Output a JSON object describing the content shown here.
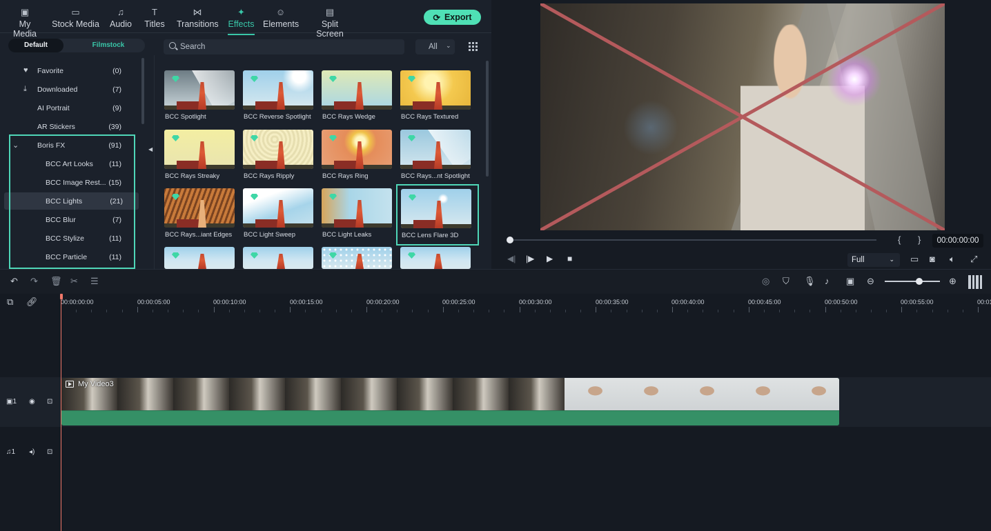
{
  "nav": {
    "tabs": [
      {
        "label": "My Media",
        "icon": "image-icon"
      },
      {
        "label": "Stock Media",
        "icon": "folder-icon"
      },
      {
        "label": "Audio",
        "icon": "music-icon"
      },
      {
        "label": "Titles",
        "icon": "text-t-icon"
      },
      {
        "label": "Transitions",
        "icon": "bowtie-icon"
      },
      {
        "label": "Effects",
        "icon": "sparkle-icon"
      },
      {
        "label": "Elements",
        "icon": "smiley-icon"
      },
      {
        "label": "Split Screen",
        "icon": "split-screen-icon"
      }
    ],
    "active": "Effects",
    "export_label": "Export"
  },
  "library": {
    "segment": [
      "Default",
      "Filmstock"
    ],
    "categories": [
      {
        "label": "Favorite",
        "count": "(0)",
        "icon": "heart-icon"
      },
      {
        "label": "Downloaded",
        "count": "(7)",
        "icon": "download-icon"
      },
      {
        "label": "AI Portrait",
        "count": "(9)"
      },
      {
        "label": "AR Stickers",
        "count": "(39)"
      },
      {
        "label": "Boris FX",
        "count": "(91)",
        "icon": "chevron-down-icon"
      },
      {
        "label": "BCC Art Looks",
        "count": "(11)"
      },
      {
        "label": "BCC Image Rest...",
        "count": "(15)"
      },
      {
        "label": "BCC Lights",
        "count": "(21)"
      },
      {
        "label": "BCC Blur",
        "count": "(7)"
      },
      {
        "label": "BCC Stylize",
        "count": "(11)"
      },
      {
        "label": "BCC Particle",
        "count": "(11)"
      }
    ],
    "selected": "BCC Lights"
  },
  "effects": {
    "search_placeholder": "Search",
    "filter_value": "All",
    "items": [
      "BCC Spotlight",
      "BCC Reverse Spotlight",
      "BCC Rays Wedge",
      "BCC Rays Textured",
      "BCC Rays Streaky",
      "BCC Rays Ripply",
      "BCC Rays Ring",
      "BCC Rays...nt Spotlight",
      "BCC Rays...iant Edges",
      "BCC Light Sweep",
      "BCC Light Leaks",
      "BCC Lens Flare 3D"
    ],
    "selected": "BCC Lens Flare 3D",
    "accent": "#4fd7b8"
  },
  "preview": {
    "timecode": "00:00:00:00",
    "quality": "Full",
    "progress": 0,
    "brace_open": "{",
    "brace_close": "}"
  },
  "timeline": {
    "ruler_labels": [
      "00:00:00:00",
      "00:00:05:00",
      "00:00:10:00",
      "00:00:15:00",
      "00:00:20:00",
      "00:00:25:00",
      "00:00:30:00",
      "00:00:35:00",
      "00:00:40:00",
      "00:00:45:00",
      "00:00:50:00",
      "00:00:55:00",
      "00:01"
    ],
    "video_track_label": "1",
    "audio_track_label": "1",
    "clip_name": "My Video3",
    "playhead_color": "#f0786a"
  }
}
